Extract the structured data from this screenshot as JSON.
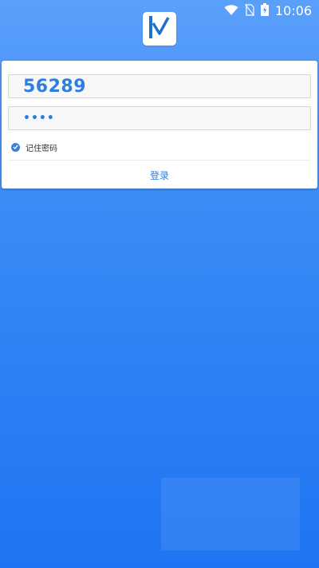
{
  "status_bar": {
    "time": "10:06",
    "icons": [
      "wifi-icon",
      "no-sim-icon",
      "battery-charging-icon"
    ]
  },
  "app": {
    "logo_icon": "app-logo-icon",
    "brand_color": "#2d7ee0"
  },
  "login_form": {
    "username_value": "56289",
    "password_value": "••••",
    "remember_label": "记住密码",
    "remember_checked": true,
    "login_button_label": "登录"
  },
  "colors": {
    "background_top": "#5aa0fb",
    "background_bottom": "#1f74f3",
    "accent": "#2d7ee0",
    "checkbox": "#3d7fd6"
  }
}
